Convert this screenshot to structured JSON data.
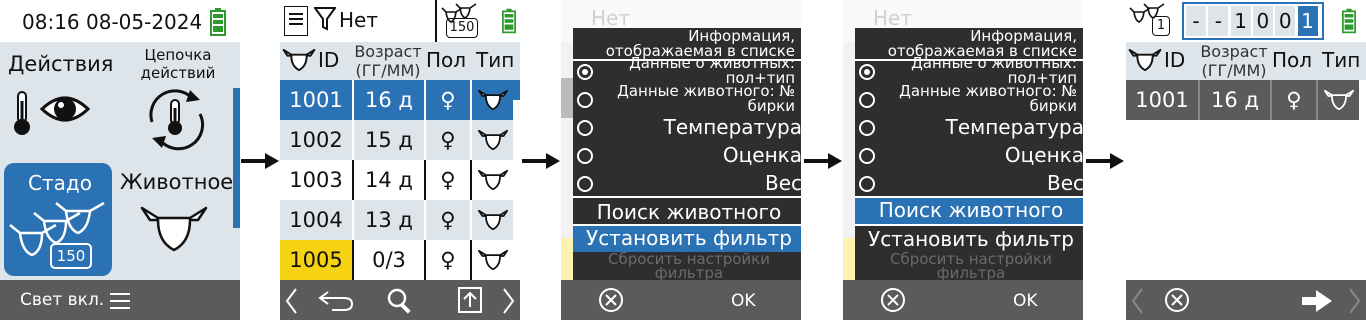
{
  "screen1": {
    "clock": "08:16 08-05-2024",
    "tiles": {
      "actions": "Действия",
      "chain": "Цепочка действий",
      "herd": "Стадо",
      "herd_count": "150",
      "animal": "Животное"
    },
    "footer_label": "Свет вкл."
  },
  "screen2": {
    "filter_label": "Нет",
    "herd_count": "150",
    "columns": {
      "id": "ID",
      "age": "Возраст",
      "age_unit": "(ГГ/ММ)",
      "sex": "Пол",
      "type": "Тип"
    },
    "rows": [
      {
        "id": "1001",
        "age": "16 д",
        "sex": "♀"
      },
      {
        "id": "1002",
        "age": "15 д",
        "sex": "♀"
      },
      {
        "id": "1003",
        "age": "14 д",
        "sex": "♀"
      },
      {
        "id": "1004",
        "age": "13 д",
        "sex": "♀"
      },
      {
        "id": "1005",
        "age": "0/3",
        "sex": "♀"
      }
    ]
  },
  "dialog": {
    "header_line1": "Информация,",
    "header_line2": "отображаемая в списке",
    "options": [
      {
        "line1": "Данные о животных:",
        "line2": "пол+тип"
      },
      {
        "line1": "Данные животного: №",
        "line2": "бирки"
      },
      {
        "line1": "Температура"
      },
      {
        "line1": "Оценка"
      },
      {
        "line1": "Вес"
      }
    ],
    "search": "Поиск животного",
    "set_filter": "Установить фильтр",
    "reset_line1": "Сбросить настройки",
    "reset_line2": "фильтра",
    "ok": "OK"
  },
  "screen5": {
    "herd_count": "1",
    "id_digits": [
      "-",
      "-",
      "1",
      "0",
      "0",
      "1"
    ],
    "columns": {
      "id": "ID",
      "age": "Возраст",
      "age_unit": "(ГГ/ММ)",
      "sex": "Пол",
      "type": "Тип"
    },
    "rows": [
      {
        "id": "1001",
        "age": "16 д",
        "sex": "♀"
      }
    ]
  },
  "colors": {
    "blue": "#2b72b4",
    "dark": "#2e2e2e",
    "bar": "#5b5b5b",
    "light": "#dde4ea",
    "yellow": "#f5d313",
    "battery": "#2e9a2e"
  }
}
